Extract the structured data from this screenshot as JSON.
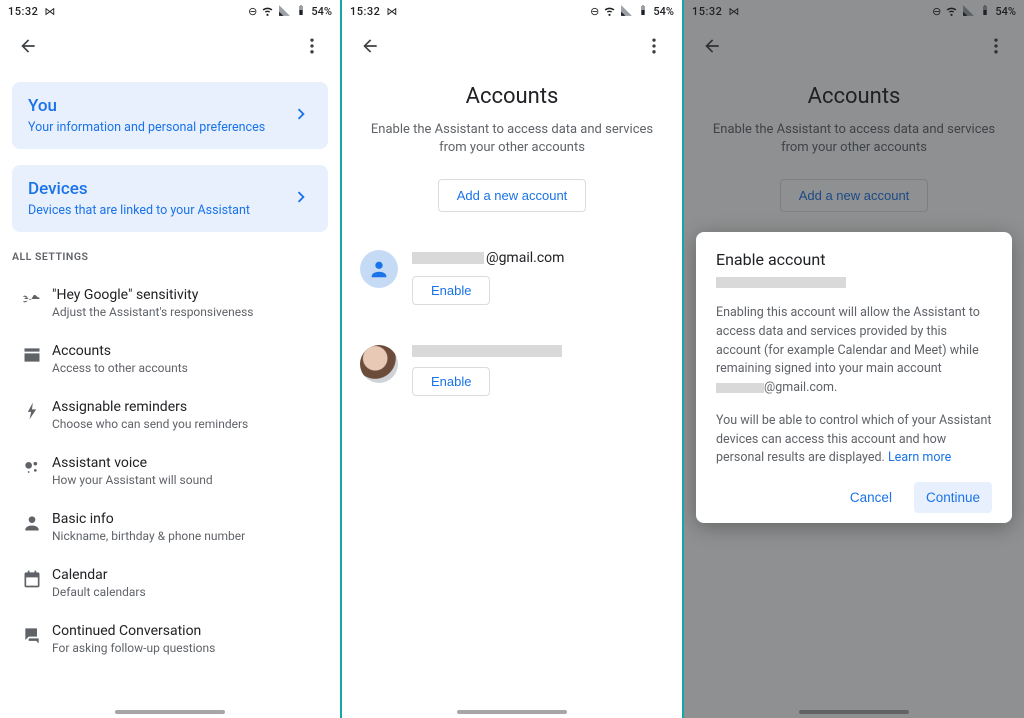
{
  "status": {
    "clock": "15:32",
    "battery": "54%",
    "bt_icon": "⋈",
    "dnd_icon": "⊖",
    "wifi_icon": "⇲",
    "sig_icon": "▮"
  },
  "screen1": {
    "cards": [
      {
        "title": "You",
        "sub": "Your information and personal preferences"
      },
      {
        "title": "Devices",
        "sub": "Devices that are linked to your Assistant"
      }
    ],
    "section_header": "All Settings",
    "settings": [
      {
        "title": "\"Hey Google\" sensitivity",
        "sub": "Adjust the Assistant's responsiveness"
      },
      {
        "title": "Accounts",
        "sub": "Access to other accounts"
      },
      {
        "title": "Assignable reminders",
        "sub": "Choose who can send you reminders"
      },
      {
        "title": "Assistant voice",
        "sub": "How your Assistant will sound"
      },
      {
        "title": "Basic info",
        "sub": "Nickname, birthday & phone number"
      },
      {
        "title": "Calendar",
        "sub": "Default calendars"
      },
      {
        "title": "Continued Conversation",
        "sub": "For asking follow-up questions"
      }
    ]
  },
  "screen2": {
    "title": "Accounts",
    "subtitle": "Enable the Assistant to access data and services from your other accounts",
    "add_button": "Add a new account",
    "accounts": [
      {
        "email_suffix": "@gmail.com",
        "enable": "Enable"
      },
      {
        "email_suffix": "",
        "enable": "Enable"
      }
    ]
  },
  "screen3": {
    "title": "Accounts",
    "subtitle": "Enable the Assistant to access data and services from your other accounts",
    "add_button": "Add a new account",
    "dialog": {
      "title": "Enable account",
      "body1_a": "Enabling this account will allow the Assistant to access data and services provided by this account (for example Calendar and Meet) while remaining signed into your main account ",
      "body1_b": "@gmail.com.",
      "body2": "You will be able to control which of your Assistant devices can access this account and how personal results are displayed. ",
      "learn_more": "Learn more",
      "cancel": "Cancel",
      "continue": "Continue"
    }
  }
}
